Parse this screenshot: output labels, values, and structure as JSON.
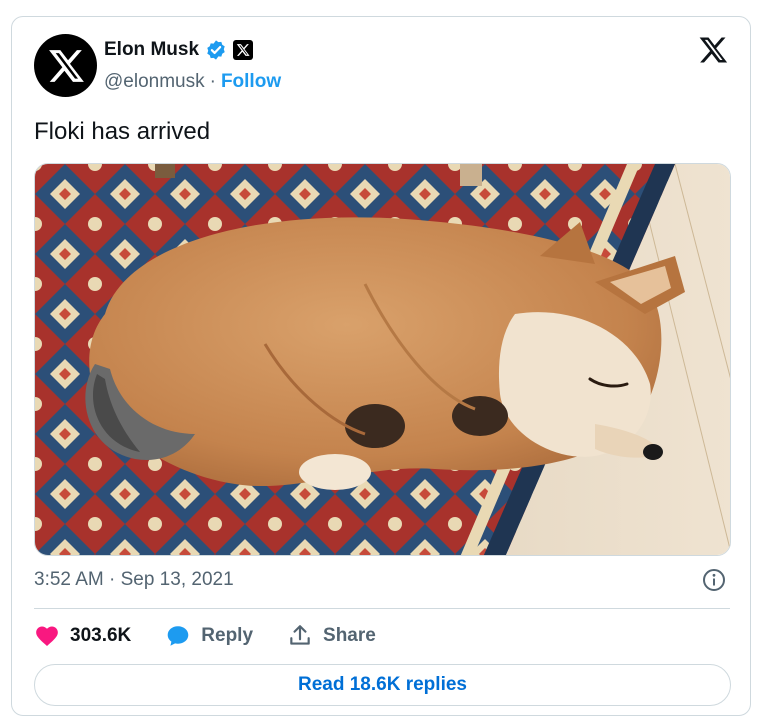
{
  "author": {
    "name": "Elon Musk",
    "handle": "@elonmusk",
    "separator": "·",
    "follow_label": "Follow"
  },
  "tweet": {
    "text": "Floki has arrived",
    "timestamp": "3:52 AM · Sep 13, 2021"
  },
  "media": {
    "icon": "sleeping-puppy-photo"
  },
  "actions": {
    "likes_count": "303.6K",
    "reply_label": "Reply",
    "share_label": "Share"
  },
  "read_replies_label": "Read 18.6K replies",
  "colors": {
    "accent": "#1d9bf0",
    "like": "#f91880",
    "text": "#0f1419",
    "muted": "#536471"
  }
}
